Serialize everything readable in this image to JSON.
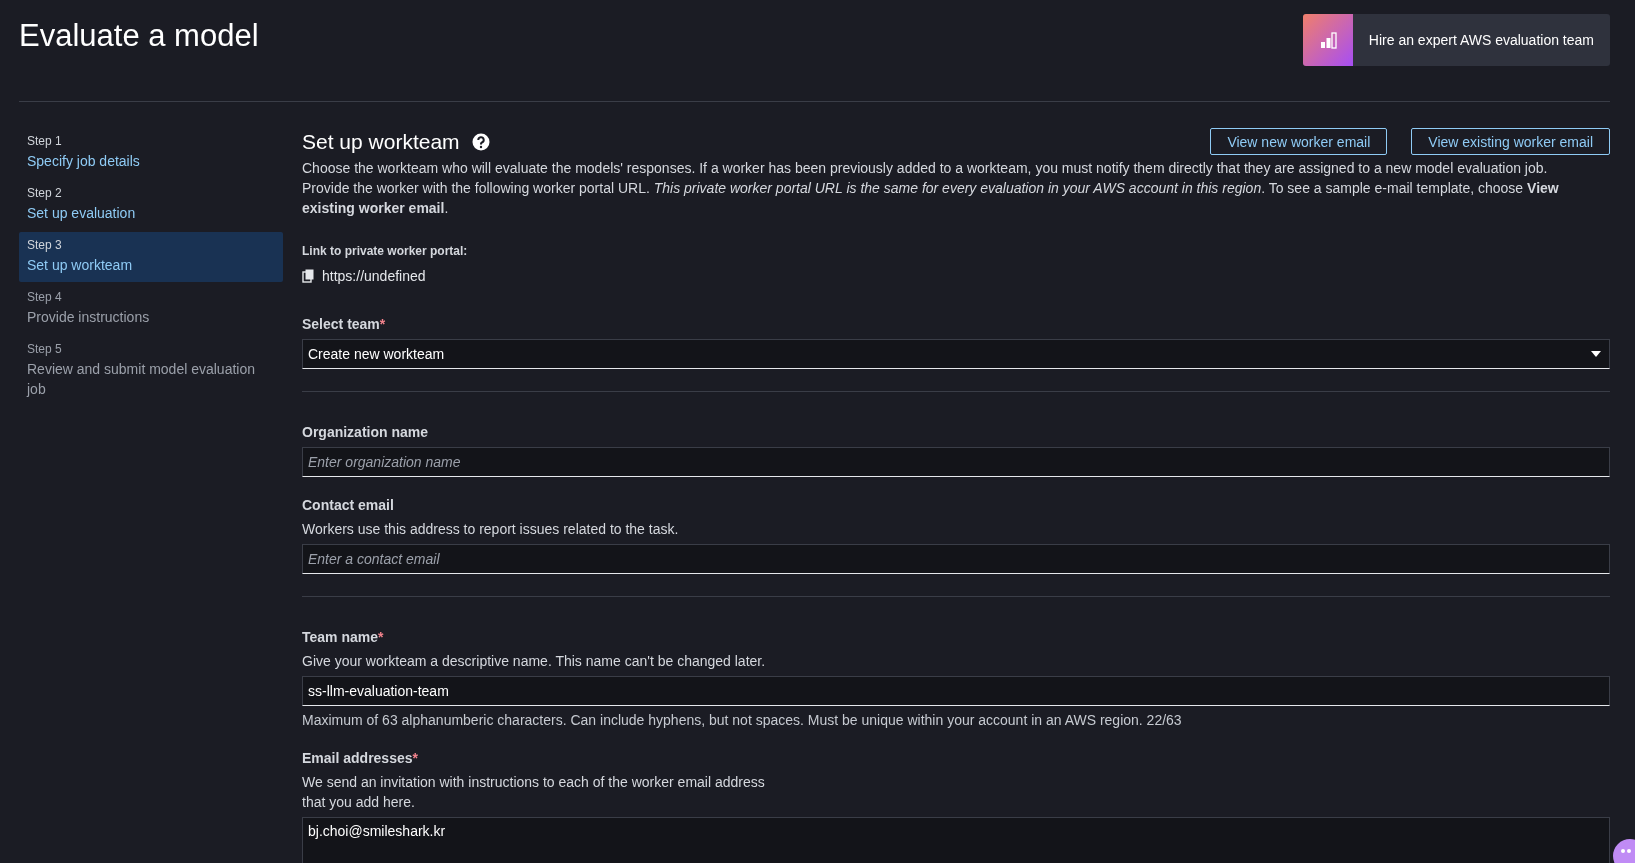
{
  "page_title": "Evaluate a model",
  "promo": {
    "label": "Hire an expert AWS evaluation team"
  },
  "steps": [
    {
      "step": "Step 1",
      "title": "Specify job details",
      "selected": false,
      "disabled": false
    },
    {
      "step": "Step 2",
      "title": "Set up evaluation",
      "selected": false,
      "disabled": false
    },
    {
      "step": "Step 3",
      "title": "Set up workteam",
      "selected": true,
      "disabled": false
    },
    {
      "step": "Step 4",
      "title": "Provide instructions",
      "selected": false,
      "disabled": true
    },
    {
      "step": "Step 5",
      "title": "Review and submit model evaluation job",
      "selected": false,
      "disabled": true
    }
  ],
  "section": {
    "title": "Set up workteam",
    "buttons": [
      "View new worker email",
      "View existing worker email"
    ],
    "description": "Choose the workteam who will evaluate the models' responses. If a worker has been previously added to a workteam, you must notify them directly that they are assigned to a new model evaluation job. Provide the worker with the following worker portal URL. *This private worker portal URL is the same for every evaluation in your AWS account in this region*. To see a sample e-mail template, choose **View existing worker email**.",
    "portal_label": "Link to private worker portal:",
    "portal_url": "https://undefined"
  },
  "groups": [
    {
      "fields": [
        {
          "kind": "select",
          "label": "Select team",
          "required_mark": "*",
          "value": "Create new workteam"
        }
      ]
    },
    {
      "fields": [
        {
          "kind": "text",
          "label": "Organization name",
          "placeholder": "Enter organization name"
        },
        {
          "kind": "text",
          "label": "Contact email",
          "description": "Workers use this address to report issues related to the task.",
          "placeholder": "Enter a contact email"
        }
      ]
    },
    {
      "fields": [
        {
          "kind": "text",
          "label": "Team name",
          "required_mark": "*",
          "description": "Give your workteam a descriptive name. This name can't be changed later.",
          "value": "ss-llm-evaluation-team",
          "hint": "Maximum of 63 alphanumberic characters. Can include hyphens, but not spaces. Must be unique within your account in an AWS region. 22/63"
        },
        {
          "kind": "textarea",
          "label": "Email addresses",
          "required_mark": "*",
          "description": "We send an invitation with instructions to each of the worker email address\nthat you add here.",
          "value": "bj.choi@smileshark.kr"
        }
      ]
    }
  ]
}
